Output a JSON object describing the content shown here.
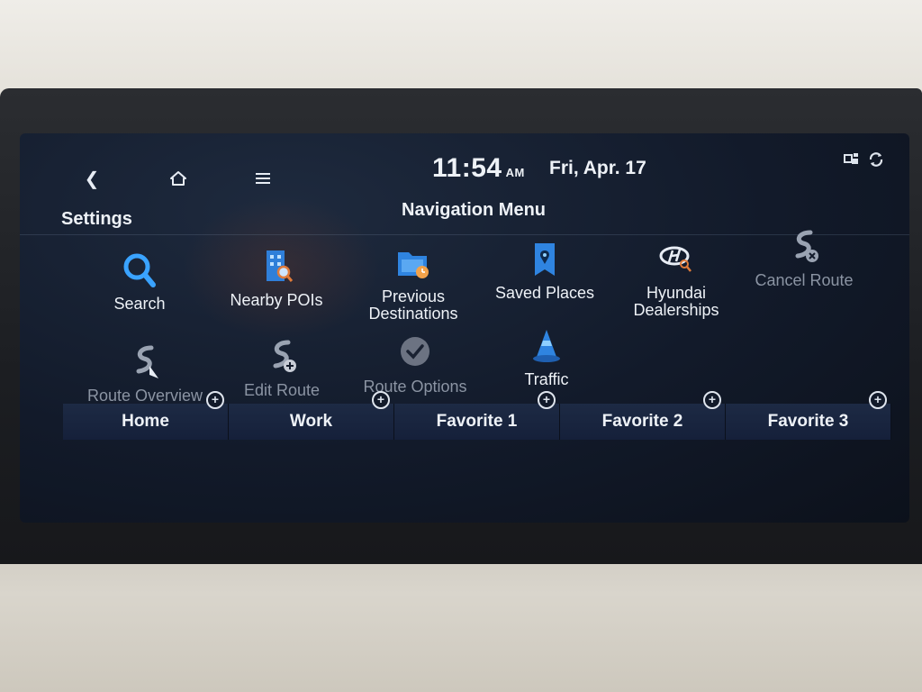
{
  "topbar": {
    "back_icon": "back-chevron-icon",
    "home_icon": "home-icon",
    "menu_icon": "hamburger-menu-icon",
    "time": "11:54",
    "ampm": "AM",
    "date": "Fri, Apr. 17",
    "status_icons": [
      "connectivity-icon",
      "sync-icon"
    ]
  },
  "header": {
    "settings_label": "Settings",
    "title": "Navigation Menu"
  },
  "menu": {
    "search": "Search",
    "nearby": "Nearby POIs",
    "previous": "Previous Destinations",
    "saved": "Saved Places",
    "dealerships": "Hyundai Dealerships",
    "cancel_route": "Cancel Route",
    "route_overview": "Route Overview",
    "edit_route": "Edit Route",
    "route_options": "Route Options",
    "traffic": "Traffic"
  },
  "favorites": {
    "home": "Home",
    "work": "Work",
    "fav1": "Favorite 1",
    "fav2": "Favorite 2",
    "fav3": "Favorite 3",
    "add_symbol": "+"
  },
  "colors": {
    "accent_blue": "#3aa3ff",
    "disabled_text": "#8b94a3",
    "screen_bg": "#121a2a"
  }
}
